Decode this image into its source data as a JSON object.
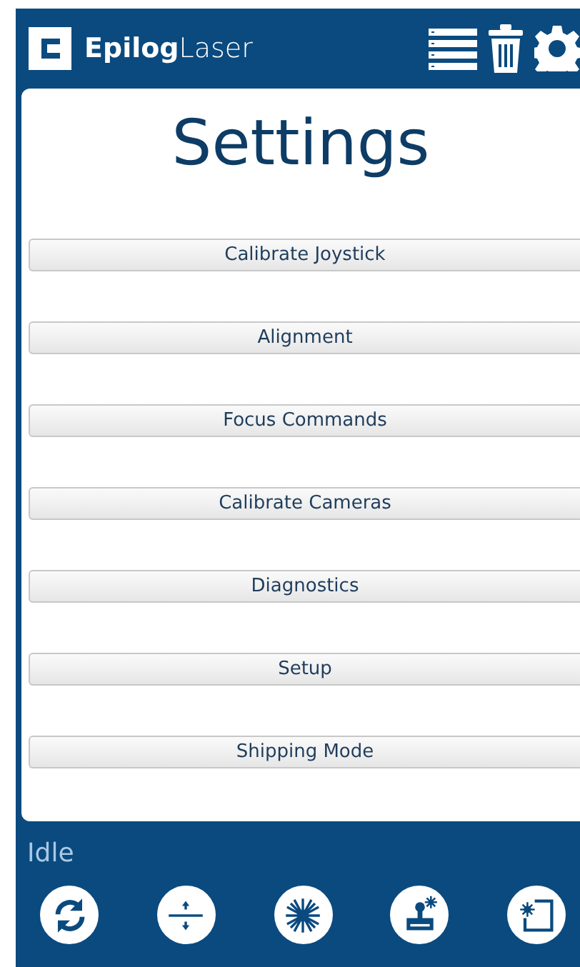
{
  "header": {
    "logo": "**Epilog**Laser"
  },
  "title": "Settings",
  "menu": [
    {
      "label": "Calibrate Joystick"
    },
    {
      "label": "Alignment"
    },
    {
      "label": "Focus Commands"
    },
    {
      "label": "Calibrate Cameras"
    },
    {
      "label": "Diagnostics"
    },
    {
      "label": "Setup"
    },
    {
      "label": "Shipping Mode"
    }
  ],
  "status": "Idle",
  "toolbar": [
    {
      "kind": "refresh"
    },
    {
      "kind": "focus"
    },
    {
      "kind": "laser"
    },
    {
      "kind": "joystick"
    },
    {
      "kind": "frame"
    }
  ]
}
